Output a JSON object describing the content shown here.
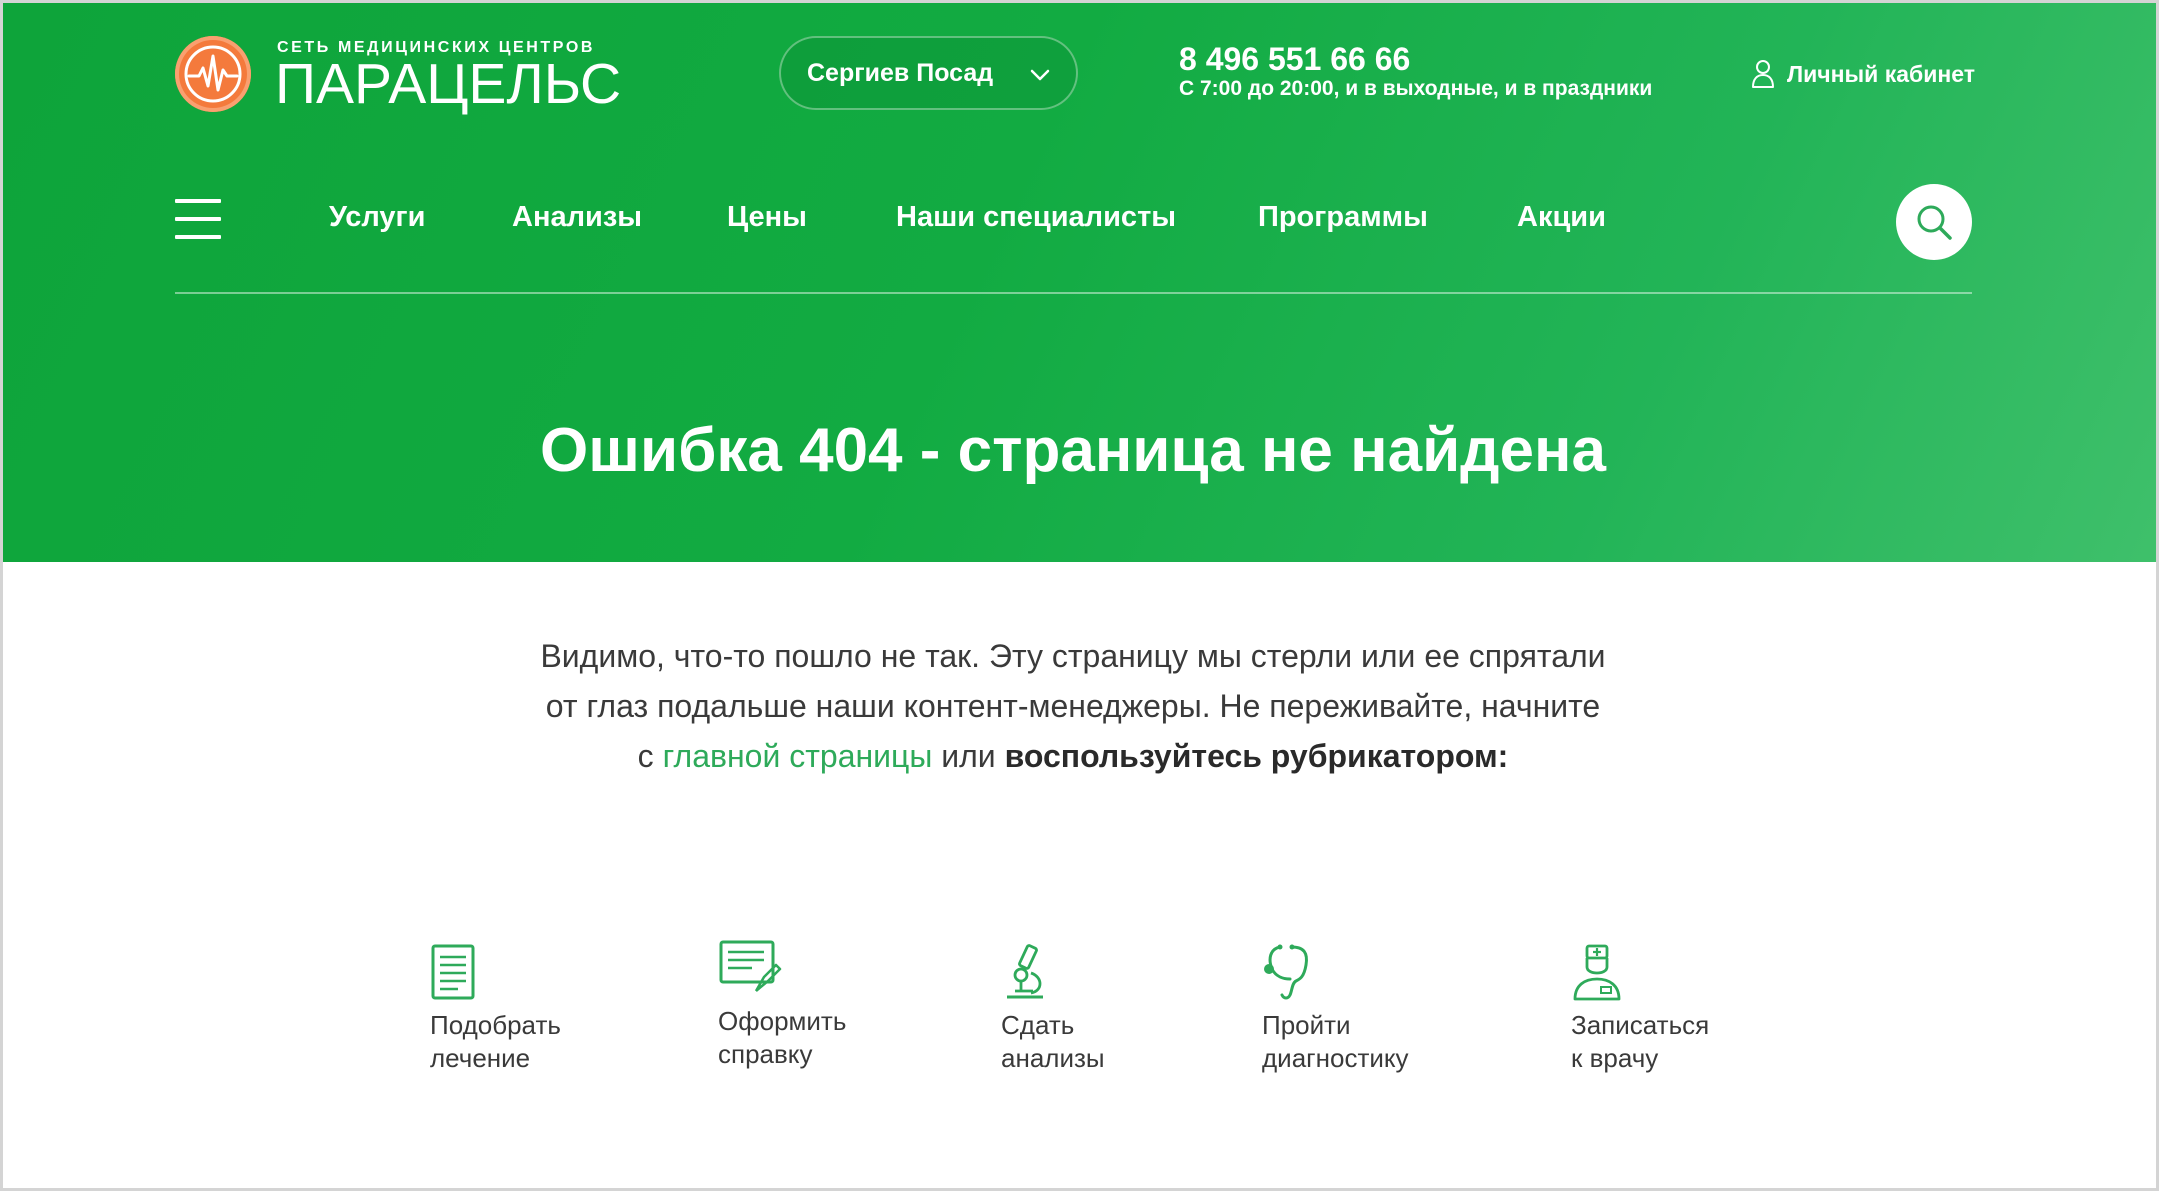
{
  "header": {
    "logo": {
      "subtitle": "СЕТЬ МЕДИЦИНСКИХ ЦЕНТРОВ",
      "name": "ПАРАЦЕЛЬС",
      "icon": "heartbeat-icon",
      "color": "#f47a3c"
    },
    "city": {
      "selected": "Сергиев Посад",
      "icon": "chevron-down-icon"
    },
    "phone": "8 496 551 66 66",
    "hours": "С 7:00 до 20:00, и в выходные, и в праздники",
    "cabinet": {
      "label": "Личный кабинет",
      "icon": "user-icon"
    },
    "menu_icon": "hamburger-icon",
    "search_icon": "search-icon",
    "nav": [
      {
        "label": "Услуги"
      },
      {
        "label": "Анализы"
      },
      {
        "label": "Цены"
      },
      {
        "label": "Наши специалисты"
      },
      {
        "label": "Программы"
      },
      {
        "label": "Акции"
      }
    ],
    "background_color": "#12ab42"
  },
  "page": {
    "title": "Ошибка 404 - страница не найдена",
    "message": {
      "line1": "Видимо, что-то пошло не так. Эту страницу мы стерли или ее спрятали",
      "line2": "от глаз подальше наши контент-менеджеры. Не переживайте, начните",
      "line3_prefix": "с",
      "home_link": "главной страницы",
      "line3_middle": "или",
      "rubricator": "воспользуйтесь рубрикатором:"
    },
    "accent_color": "#2eaa5a"
  },
  "rubrics": [
    {
      "line1": "Подобрать",
      "line2": "лечение",
      "icon": "document-list-icon"
    },
    {
      "line1": "Оформить",
      "line2": "справку",
      "icon": "certificate-pen-icon"
    },
    {
      "line1": "Сдать",
      "line2": "анализы",
      "icon": "microscope-icon"
    },
    {
      "line1": "Пройти",
      "line2": "диагностику",
      "icon": "stethoscope-icon"
    },
    {
      "line1": "Записаться",
      "line2": "к врачу",
      "icon": "doctor-icon"
    }
  ]
}
